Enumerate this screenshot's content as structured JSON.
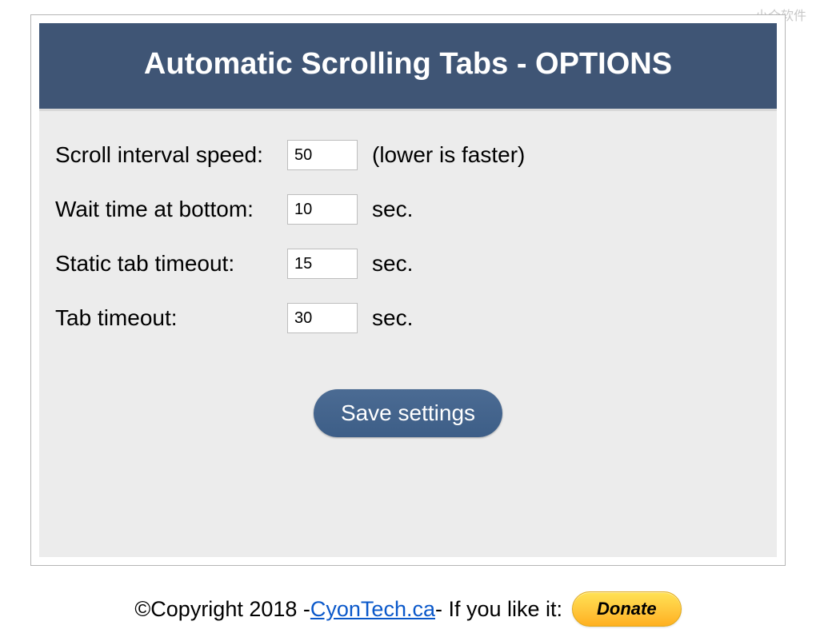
{
  "watermark": "小众软件",
  "header": {
    "title": "Automatic Scrolling Tabs - OPTIONS"
  },
  "form": {
    "scroll_interval": {
      "label": "Scroll interval speed:",
      "value": "50",
      "hint": "(lower is faster)"
    },
    "wait_bottom": {
      "label": "Wait time at bottom:",
      "value": "10",
      "hint": "sec."
    },
    "static_timeout": {
      "label": "Static tab timeout:",
      "value": "15",
      "hint": "sec."
    },
    "tab_timeout": {
      "label": "Tab timeout:",
      "value": "30",
      "hint": "sec."
    },
    "save_label": "Save settings"
  },
  "footer": {
    "copyright_prefix": "©Copyright 2018 - ",
    "link_text": "CyonTech.ca",
    "copyright_suffix": " - If you like it: ",
    "donate_label": "Donate"
  }
}
